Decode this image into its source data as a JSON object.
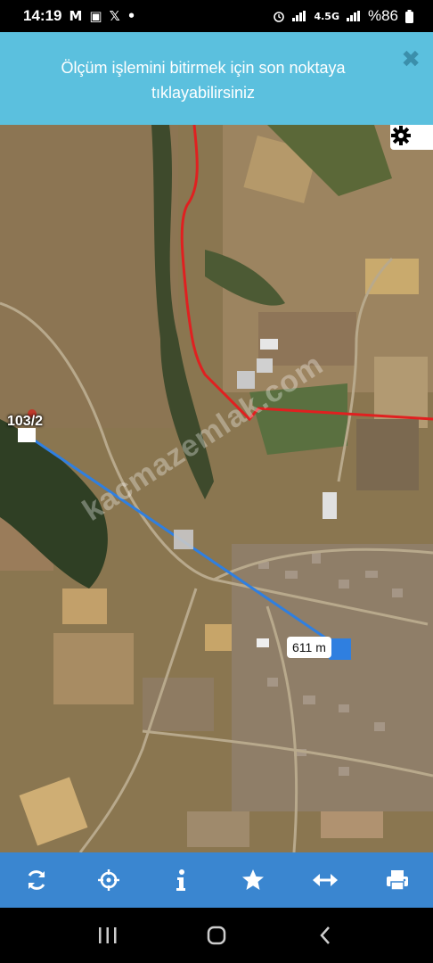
{
  "status_bar": {
    "time": "14:19",
    "notif_icons": [
      "M",
      "▣",
      "𝕏",
      "•"
    ],
    "battery": "%86",
    "network": "4.5G"
  },
  "banner": {
    "message_line1": "Ölçüm işlemini bitirmek için son noktaya",
    "message_line2": "tıklayabilirsiniz",
    "background": "#5bc0de"
  },
  "map": {
    "parcel_label": "103/2",
    "distance_label": "611 m",
    "watermark": "kacmazemlak.com",
    "boundary_color": "#e02020",
    "measure_line_color": "#2f7fe0"
  },
  "toolbar": {
    "buttons": [
      "refresh-icon",
      "locate-icon",
      "info-icon",
      "favorite-icon",
      "measure-icon",
      "print-icon"
    ],
    "background": "#3a86d0"
  },
  "navbar": {
    "buttons": [
      "recents-icon",
      "home-icon",
      "back-icon"
    ]
  }
}
